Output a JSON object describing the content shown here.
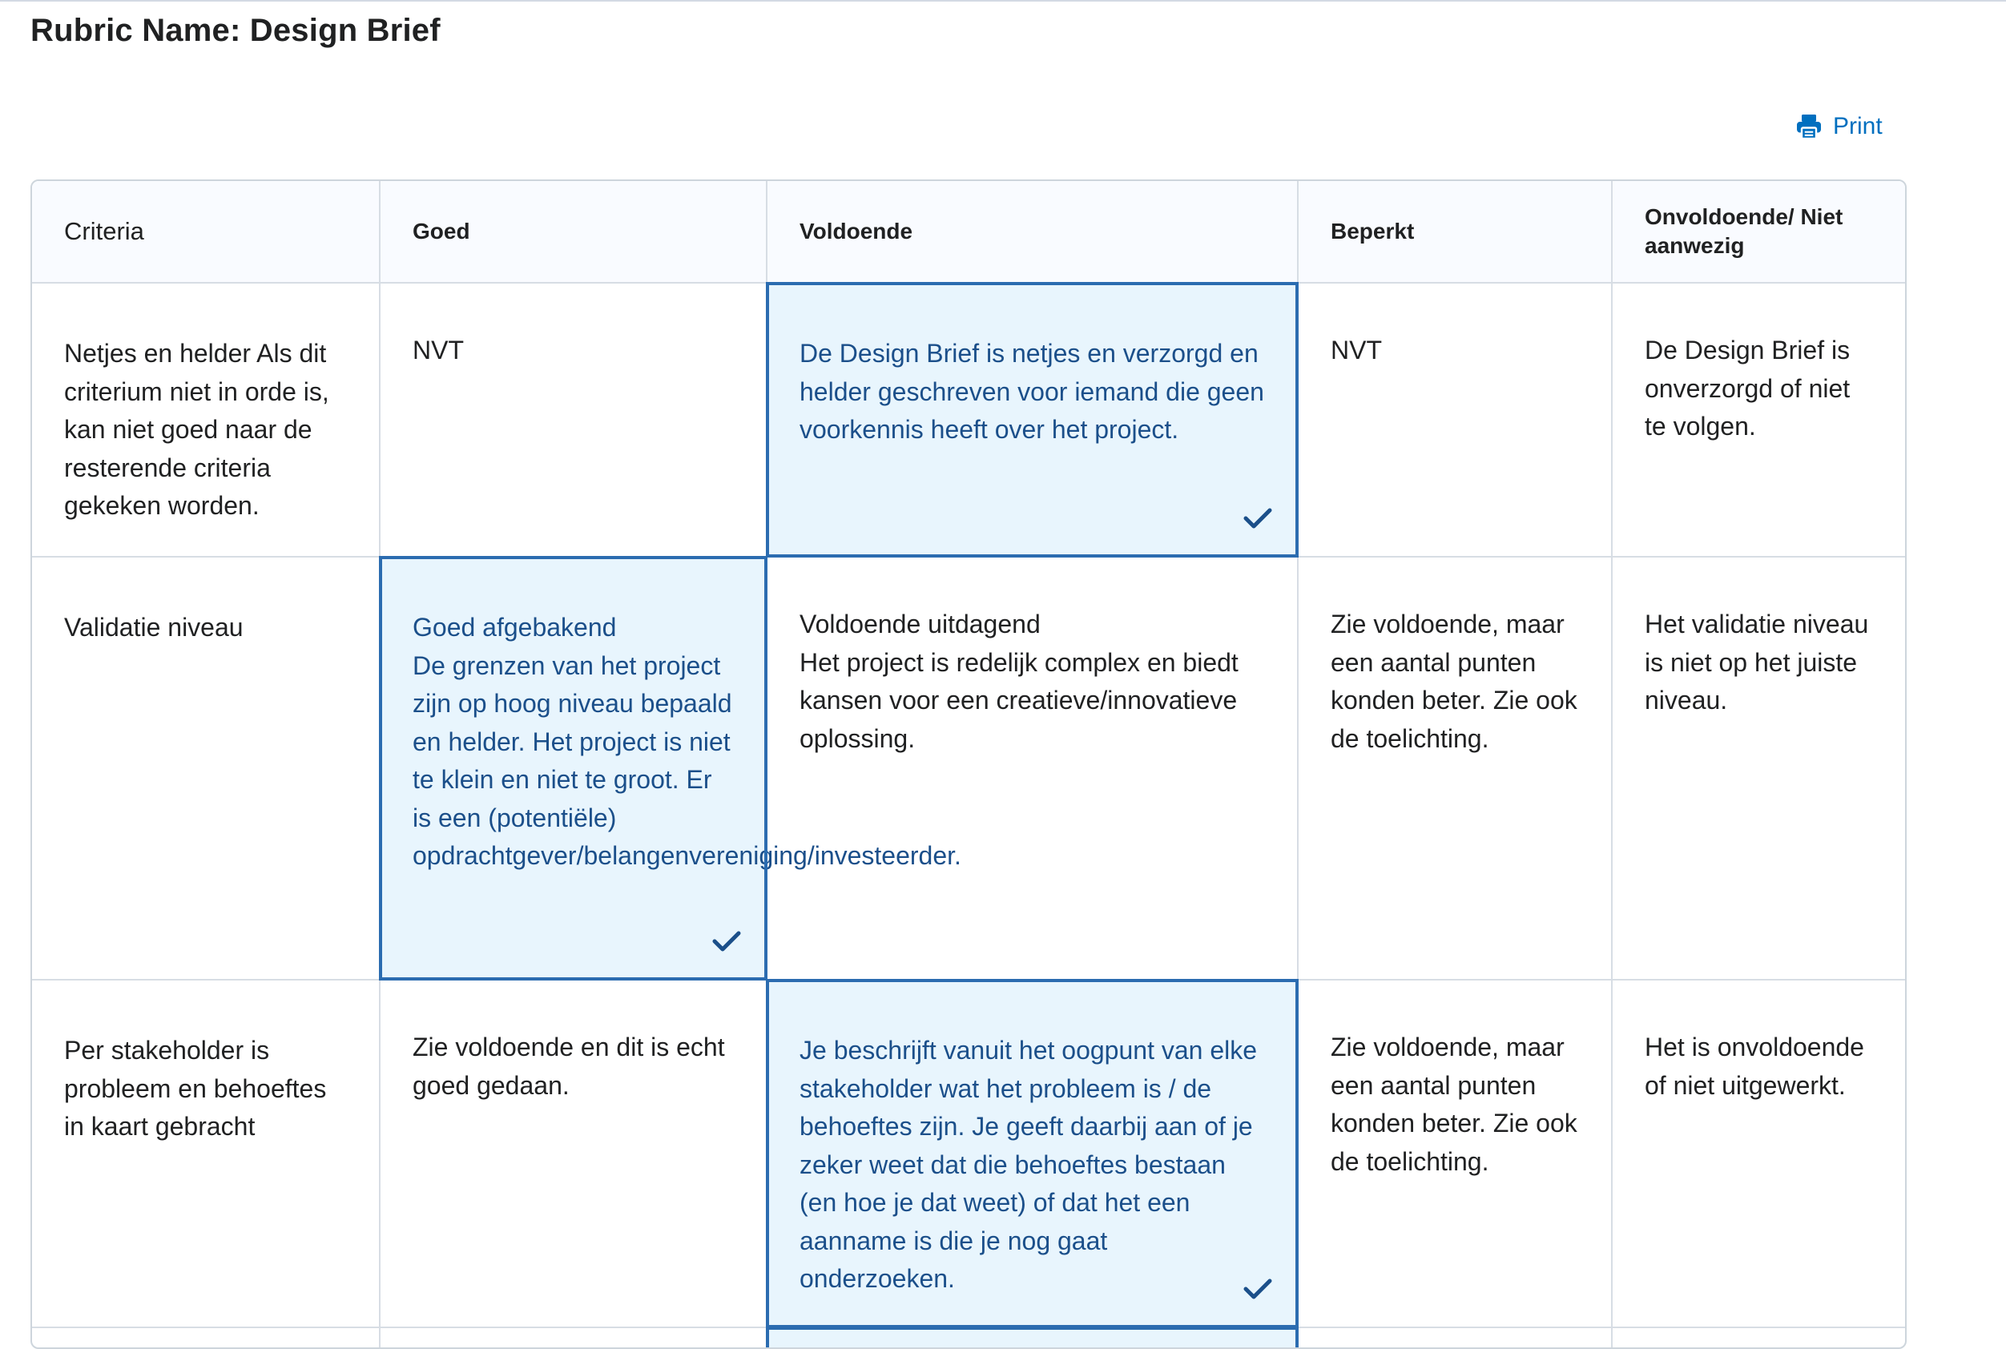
{
  "page": {
    "title": "Rubric Name: Design Brief",
    "print_label": "Print"
  },
  "table": {
    "headers": [
      "Criteria",
      "Goed",
      "Voldoende",
      "Beperkt",
      "Onvoldoende/ Niet aanwezig"
    ],
    "rows": [
      {
        "criterion": "Netjes en helder Als dit criterium niet in orde is, kan niet goed naar de resterende criteria gekeken worden.",
        "cells": [
          "NVT",
          "De Design Brief is netjes en verzorgd en helder geschreven voor iemand die geen voorkennis heeft over het project.",
          "NVT",
          "De Design Brief is onverzorgd of niet te volgen."
        ],
        "selected_level": "Voldoende"
      },
      {
        "criterion": "Validatie niveau",
        "cells": [
          "Goed afgebakend\nDe grenzen van het project zijn op hoog niveau bepaald en helder. Het project is niet te klein en niet te groot. Er is een (potentiële) opdrachtgever/belangenvereniging/investeerder.",
          "Voldoende uitdagend\nHet project is redelijk complex en biedt kansen voor een creatieve/innovatieve oplossing.",
          "Zie voldoende, maar een aantal punten konden beter. Zie ook de toelichting.",
          "Het validatie niveau is niet op het juiste niveau."
        ],
        "selected_level": "Goed"
      },
      {
        "criterion": "Per stakeholder is probleem en behoeftes in kaart gebracht",
        "cells": [
          "Zie voldoende en dit is echt goed gedaan.",
          "Je beschrijft vanuit het oogpunt van elke stakeholder wat het probleem is / de behoeftes zijn. Je geeft daarbij aan of je zeker weet dat die behoeftes bestaan (en hoe je dat weet) of dat het een aanname is die je nog gaat onderzoeken.",
          "Zie voldoende, maar een aantal punten konden beter. Zie ook de toelichting.",
          "Het is onvoldoende of niet uitgewerkt."
        ],
        "selected_level": "Voldoende"
      }
    ]
  },
  "icons": {
    "print": "printer-icon",
    "selected": "checkmark-icon"
  },
  "colors": {
    "accent": "#006fbf",
    "selected_bg": "#e8f5fd",
    "selected_border": "#2b6cb0",
    "selected_text": "#1b4f8a",
    "header_bg": "#f9fbff"
  }
}
